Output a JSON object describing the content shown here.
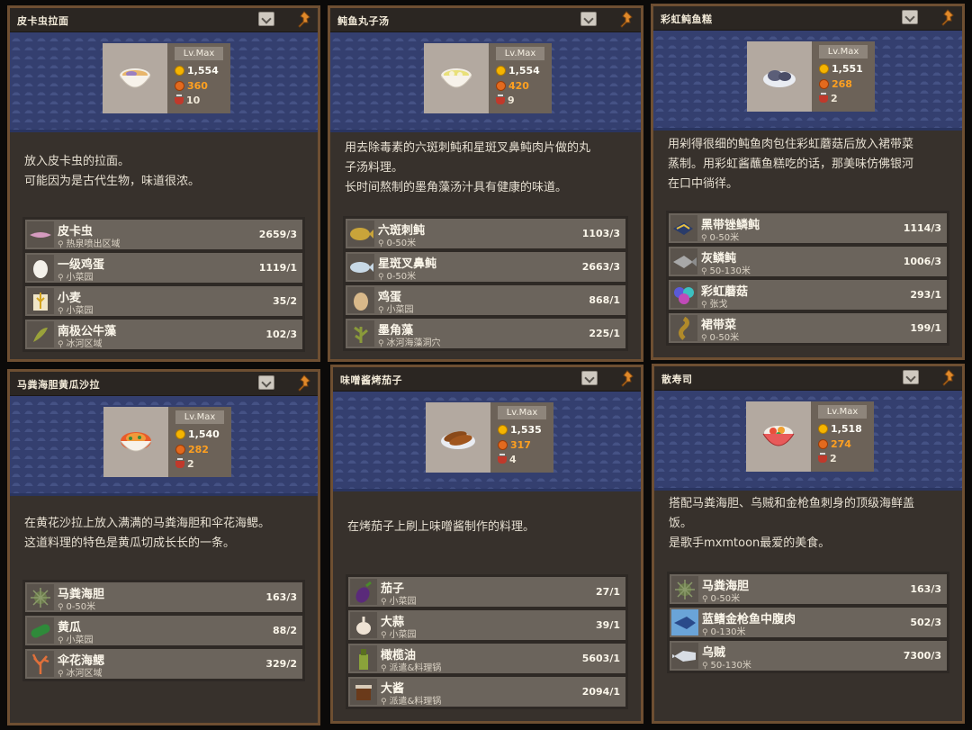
{
  "cards": [
    {
      "title": "皮卡虫拉面",
      "level": "Lv.Max",
      "price": "1,554",
      "energy": "360",
      "cooks": "10",
      "dish_icon": "ramen-bowl-icon",
      "description": [
        "放入皮卡虫的拉面。",
        "可能因为是古代生物，味道很浓。"
      ],
      "ingredients": [
        {
          "name": "皮卡虫",
          "location": "热泉喷出区域",
          "count": "2659/3",
          "icon": "pikaia-icon"
        },
        {
          "name": "一级鸡蛋",
          "location": "小菜园",
          "count": "1119/1",
          "icon": "egg-icon"
        },
        {
          "name": "小麦",
          "location": "小菜园",
          "count": "35/2",
          "icon": "wheat-icon"
        },
        {
          "name": "南极公牛藻",
          "location": "冰河区域",
          "count": "102/3",
          "icon": "kelp-icon"
        }
      ]
    },
    {
      "title": "鲀鱼丸子汤",
      "level": "Lv.Max",
      "price": "1,554",
      "energy": "420",
      "cooks": "9",
      "dish_icon": "soup-bowl-icon",
      "description": [
        "用去除毒素的六斑刺鲀和星斑叉鼻鲀肉片做的丸",
        "子汤料理。",
        "长时间熬制的墨角藻汤汁具有健康的味道。"
      ],
      "ingredients": [
        {
          "name": "六斑刺鲀",
          "location": "0-50米",
          "count": "1103/3",
          "icon": "pufferfish-icon"
        },
        {
          "name": "星斑叉鼻鲀",
          "location": "0-50米",
          "count": "2663/3",
          "icon": "puffer-spotted-icon"
        },
        {
          "name": "鸡蛋",
          "location": "小菜园",
          "count": "868/1",
          "icon": "egg-icon"
        },
        {
          "name": "墨角藻",
          "location": "冰河海藻洞穴",
          "count": "225/1",
          "icon": "seaweed-icon"
        }
      ]
    },
    {
      "title": "彩虹鲀鱼糕",
      "level": "Lv.Max",
      "price": "1,551",
      "energy": "268",
      "cooks": "2",
      "dish_icon": "fishcake-plate-icon",
      "description": [
        "用剁得很细的鲀鱼肉包住彩虹蘑菇后放入裙带菜",
        "蒸制。用彩虹酱蘸鱼糕吃的话，那美味仿佛银河",
        "在口中徜徉。"
      ],
      "ingredients": [
        {
          "name": "黑带锉鳞鲀",
          "location": "0-50米",
          "count": "1114/3",
          "icon": "triggerfish-icon"
        },
        {
          "name": "灰鳞鲀",
          "location": "50-130米",
          "count": "1006/3",
          "icon": "grey-fish-icon"
        },
        {
          "name": "彩虹蘑菇",
          "location": "张戈",
          "count": "293/1",
          "icon": "mushroom-icon"
        },
        {
          "name": "裙带菜",
          "location": "0-50米",
          "count": "199/1",
          "icon": "wakame-icon"
        }
      ]
    },
    {
      "title": "马粪海胆黄瓜沙拉",
      "level": "Lv.Max",
      "price": "1,540",
      "energy": "282",
      "cooks": "2",
      "dish_icon": "salad-bowl-icon",
      "description": [
        "在黄花沙拉上放入满满的马粪海胆和伞花海鳃。",
        "这道料理的特色是黄瓜切成长长的一条。"
      ],
      "ingredients": [
        {
          "name": "马粪海胆",
          "location": "0-50米",
          "count": "163/3",
          "icon": "urchin-icon"
        },
        {
          "name": "黄瓜",
          "location": "小菜园",
          "count": "88/2",
          "icon": "cucumber-icon"
        },
        {
          "name": "伞花海鳃",
          "location": "冰河区域",
          "count": "329/2",
          "icon": "coral-icon"
        }
      ]
    },
    {
      "title": "味噌酱烤茄子",
      "level": "Lv.Max",
      "price": "1,535",
      "energy": "317",
      "cooks": "4",
      "dish_icon": "grilled-eggplant-icon",
      "description": [
        "在烤茄子上刷上味噌酱制作的料理。"
      ],
      "ingredients": [
        {
          "name": "茄子",
          "location": "小菜园",
          "count": "27/1",
          "icon": "eggplant-icon"
        },
        {
          "name": "大蒜",
          "location": "小菜园",
          "count": "39/1",
          "icon": "garlic-icon"
        },
        {
          "name": "橄榄油",
          "location": "派遣&料理锅",
          "count": "5603/1",
          "icon": "olive-oil-icon"
        },
        {
          "name": "大酱",
          "location": "派遣&料理锅",
          "count": "2094/1",
          "icon": "soybean-paste-icon"
        }
      ]
    },
    {
      "title": "散寿司",
      "level": "Lv.Max",
      "price": "1,518",
      "energy": "274",
      "cooks": "2",
      "dish_icon": "chirashi-bowl-icon",
      "description": [
        "搭配马粪海胆、乌贼和金枪鱼刺身的顶级海鲜盖",
        "饭。",
        "是歌手mxmtoon最爱的美食。"
      ],
      "ingredients": [
        {
          "name": "马粪海胆",
          "location": "0-50米",
          "count": "163/3",
          "icon": "urchin-icon"
        },
        {
          "name": "蓝鳍金枪鱼中腹肉",
          "location": "0-130米",
          "count": "502/3",
          "icon": "tuna-icon"
        },
        {
          "name": "乌贼",
          "location": "50-130米",
          "count": "7300/3",
          "icon": "squid-icon"
        }
      ]
    }
  ]
}
